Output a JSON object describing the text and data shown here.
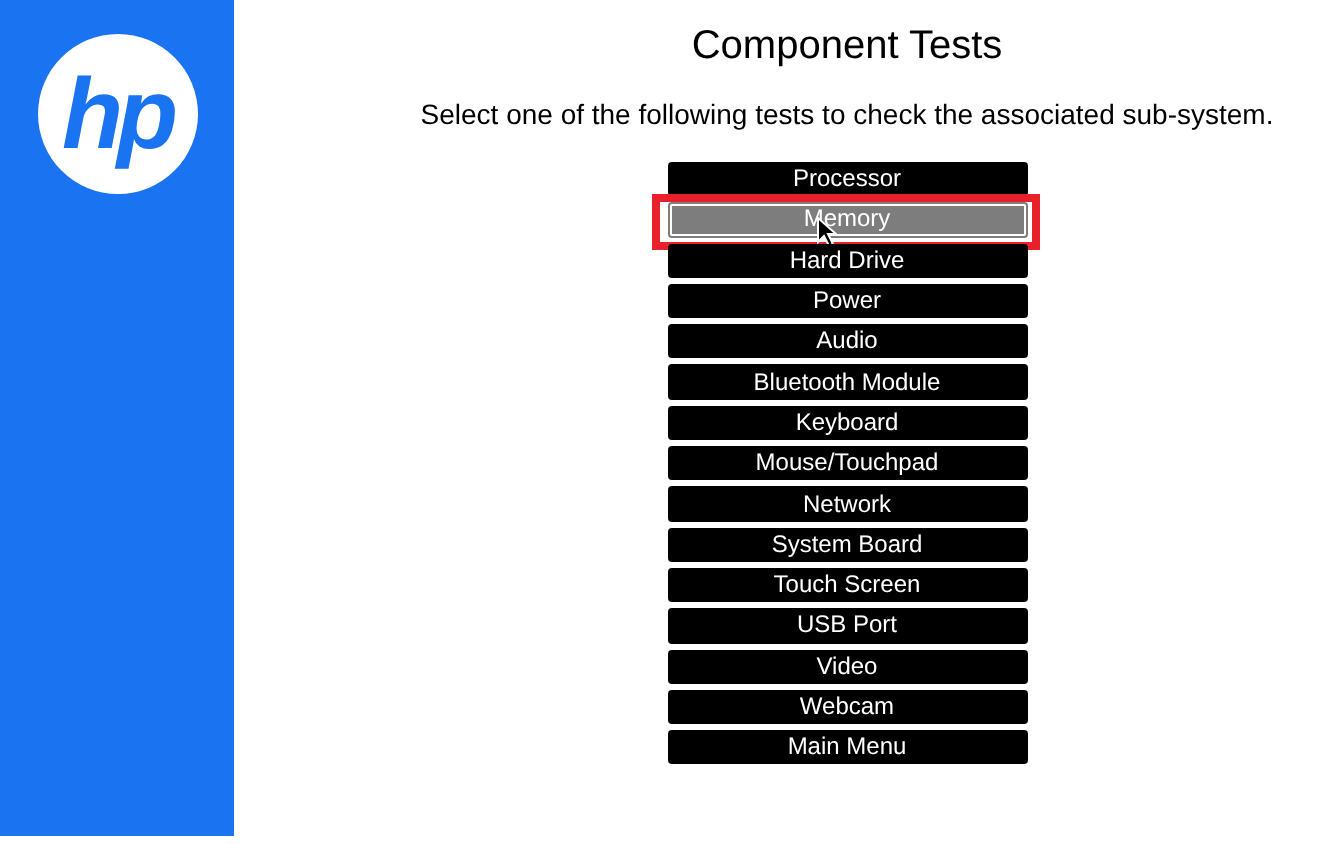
{
  "logo": {
    "text": "hp"
  },
  "title": "Component Tests",
  "subtitle": "Select one of the following tests to check the associated sub-system.",
  "tests": [
    {
      "label": "Processor",
      "selected": false
    },
    {
      "label": "Memory",
      "selected": true
    },
    {
      "label": "Hard Drive",
      "selected": false
    },
    {
      "label": "Power",
      "selected": false
    },
    {
      "label": "Audio",
      "selected": false
    },
    {
      "label": "Bluetooth Module",
      "selected": false
    },
    {
      "label": "Keyboard",
      "selected": false
    },
    {
      "label": "Mouse/Touchpad",
      "selected": false
    },
    {
      "label": "Network",
      "selected": false
    },
    {
      "label": "System Board",
      "selected": false
    },
    {
      "label": "Touch Screen",
      "selected": false
    },
    {
      "label": "USB Port",
      "selected": false
    },
    {
      "label": "Video",
      "selected": false
    },
    {
      "label": "Webcam",
      "selected": false
    },
    {
      "label": "Main Menu",
      "selected": false
    }
  ]
}
